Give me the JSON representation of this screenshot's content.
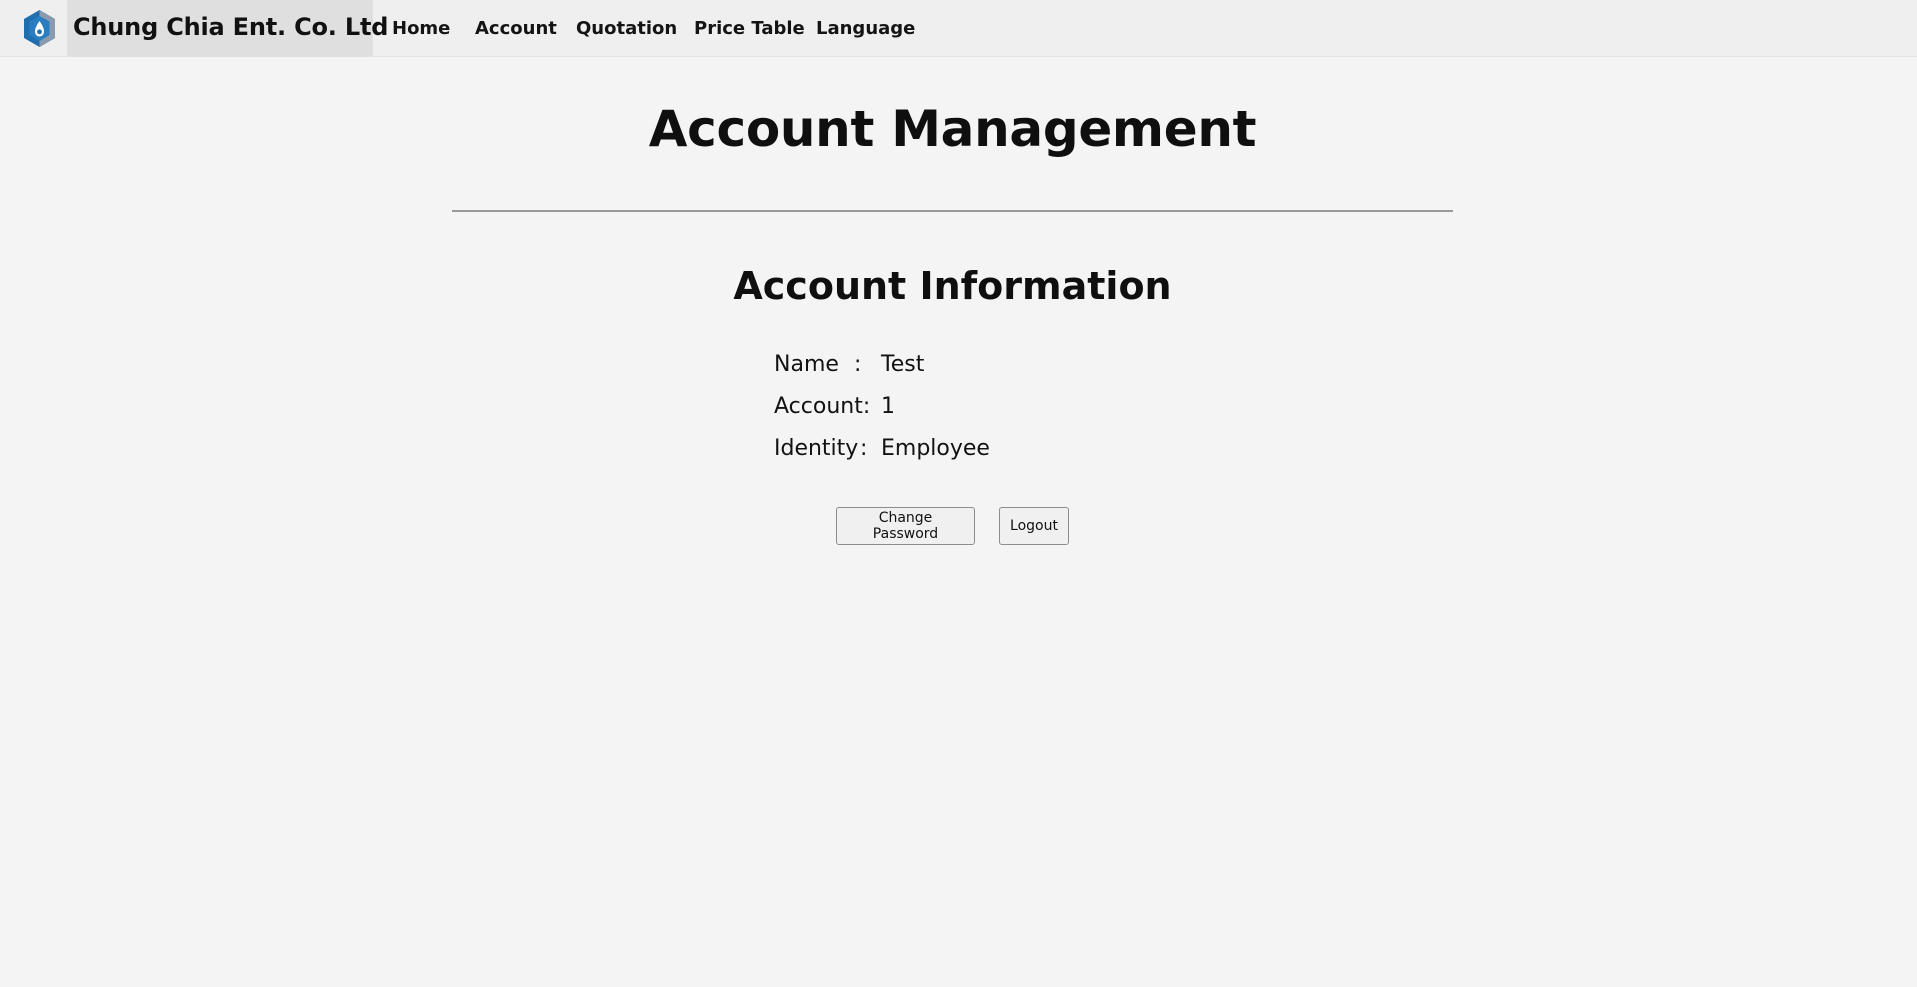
{
  "navbar": {
    "brand": "Chung Chia Ent. Co. Ltd",
    "logo_icon": "hexagon-drop-logo-icon",
    "links": [
      "Home",
      "Account",
      "Quotation",
      "Price Table",
      "Language"
    ]
  },
  "page": {
    "title": "Account Management"
  },
  "account_info": {
    "heading": "Account Information",
    "name_label": "Name",
    "name_colon": ":",
    "name_value": "Test",
    "account_label": "Account:",
    "account_value": "1",
    "identity_label": "Identity",
    "identity_colon": ":",
    "identity_value": "Employee"
  },
  "actions": {
    "change_password": "Change Password",
    "logout": "Logout"
  },
  "colors": {
    "background": "#f4f4f5",
    "navbar": "#efefef",
    "brand_box": "#dfdfdf",
    "logo_blue": "#1f6fae",
    "logo_gray": "#8a9bb0"
  }
}
